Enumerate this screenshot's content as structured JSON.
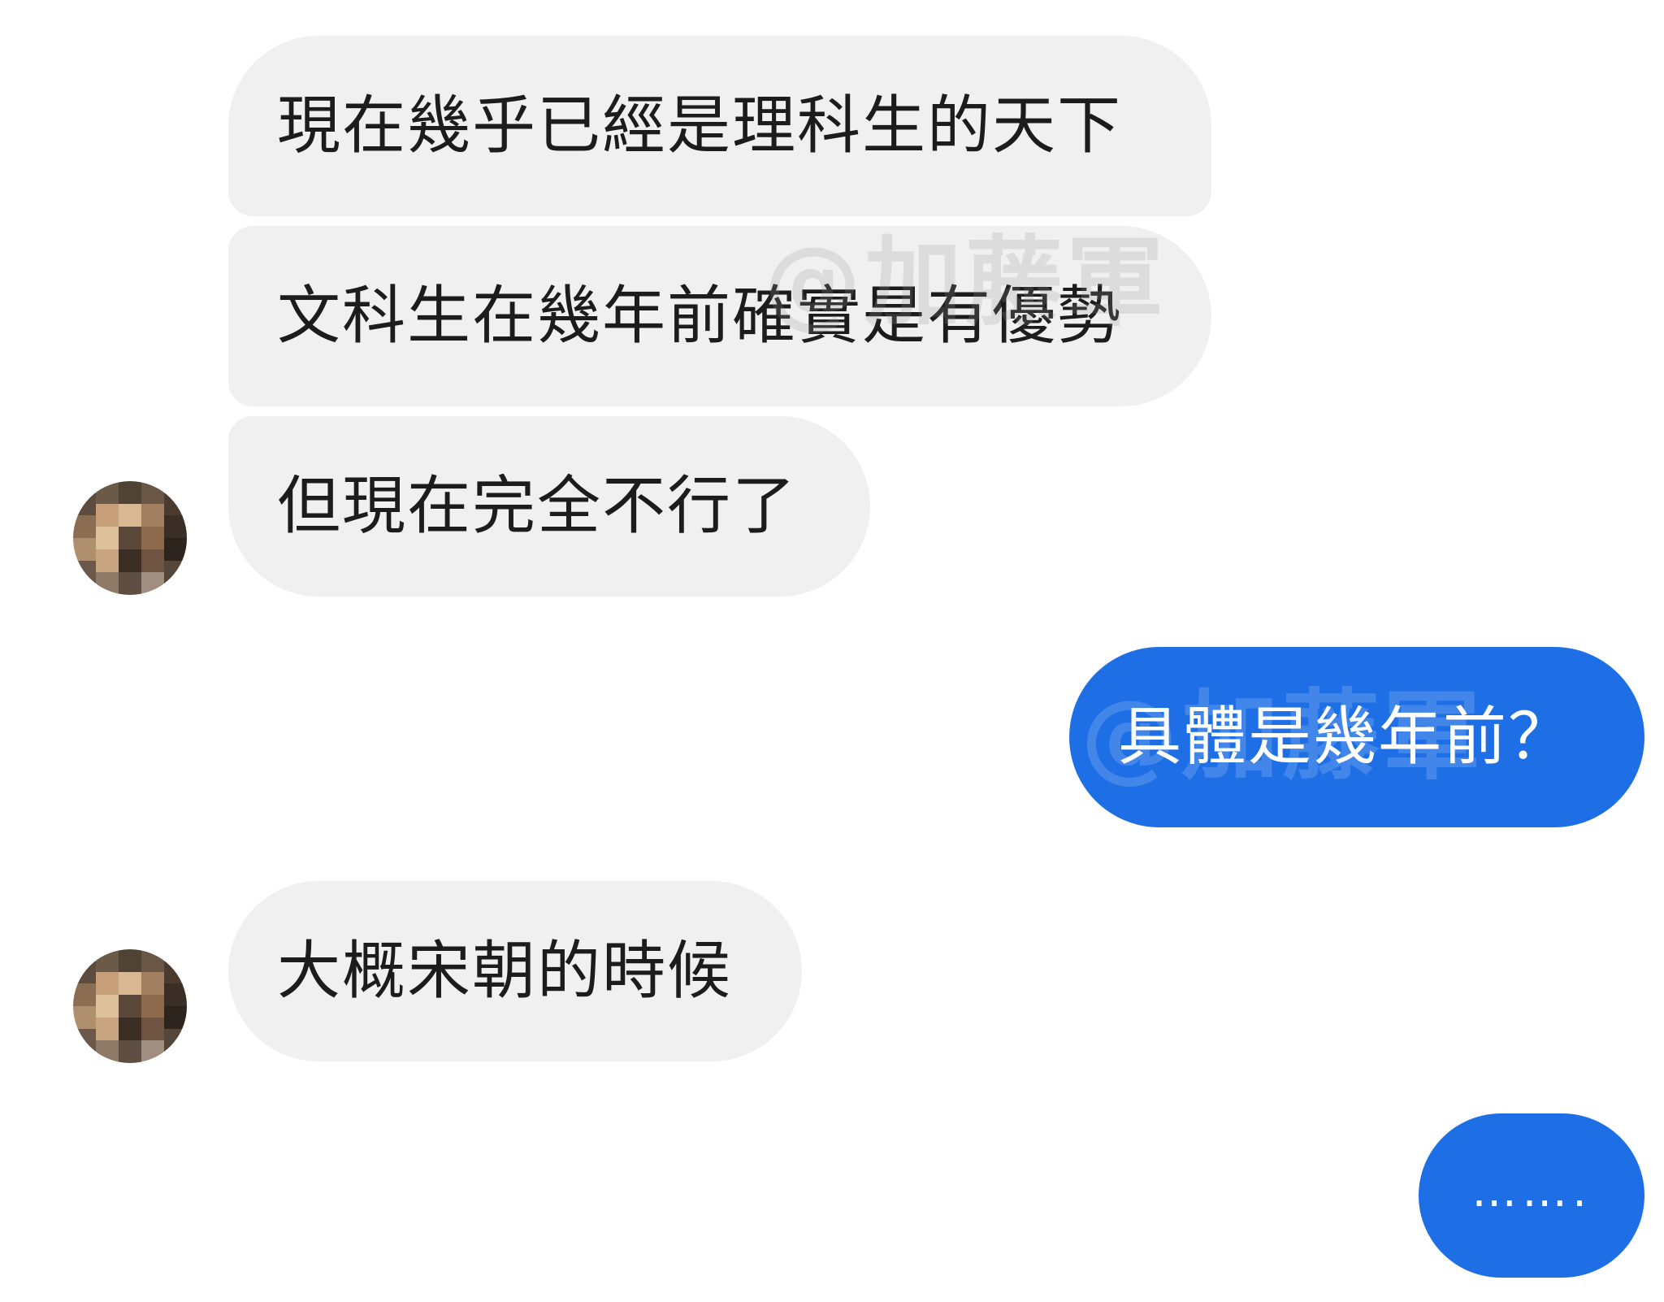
{
  "conversation": {
    "incoming": [
      {
        "text": "現在幾乎已經是理科生的天下"
      },
      {
        "text": "文科生在幾年前確實是有優勢"
      },
      {
        "text": "但現在完全不行了"
      },
      {
        "text": "大概宋朝的時候"
      }
    ],
    "outgoing": [
      {
        "text": "具體是幾年前？"
      },
      {
        "text": "……."
      }
    ]
  },
  "watermark": {
    "text": "@加藤軍"
  },
  "colors": {
    "incoming_bubble": "#f0f0f0",
    "outgoing_bubble": "#1e6fe6",
    "incoming_text": "#1c1c1c",
    "outgoing_text": "#ffffff"
  },
  "icons": {
    "avatar": "pixelated-avatar-icon"
  }
}
